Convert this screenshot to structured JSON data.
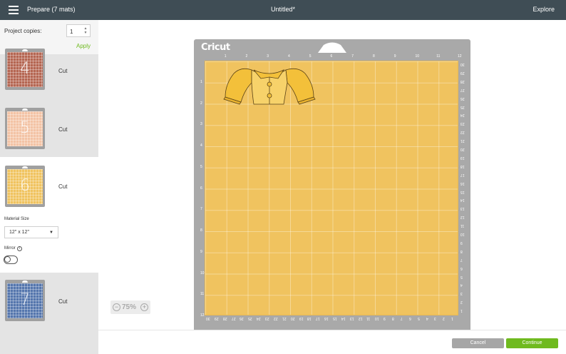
{
  "header": {
    "menu_icon": "hamburger-menu-icon",
    "title": "Prepare (7 mats)",
    "document_name": "Untitled*",
    "explore_label": "Explore"
  },
  "sidebar": {
    "copies_label": "Project copies:",
    "copies_value": "1",
    "apply_label": "Apply",
    "mats": [
      {
        "number": "4",
        "action": "Cut",
        "color": "#b56652"
      },
      {
        "number": "5",
        "action": "Cut",
        "color": "#f3c3a5"
      },
      {
        "number": "6",
        "action": "Cut",
        "color": "#f0c35f"
      },
      {
        "number": "7",
        "action": "Cut",
        "color": "#5576ad"
      }
    ],
    "material_size_label": "Material Size",
    "material_size_value": "12\" x 12\"",
    "mirror_label": "Mirror",
    "mirror_info": "i",
    "mirror_on": false
  },
  "zoom": {
    "out": "−",
    "value": "75%",
    "in": "+"
  },
  "mat": {
    "logo": "Cricut",
    "top_ruler": [
      "1",
      "2",
      "3",
      "4",
      "5",
      "6",
      "7",
      "8",
      "9",
      "10",
      "11",
      "12"
    ],
    "left_ruler": [
      "1",
      "2",
      "3",
      "4",
      "5",
      "6",
      "7",
      "8",
      "9",
      "10",
      "11",
      "12"
    ],
    "right_ruler": [
      "30",
      "29",
      "28",
      "27",
      "26",
      "25",
      "24",
      "23",
      "22",
      "21",
      "20",
      "19",
      "18",
      "17",
      "16",
      "15",
      "14",
      "13",
      "12",
      "11",
      "10",
      "9",
      "8",
      "7",
      "6",
      "5",
      "4",
      "3",
      "2",
      "1"
    ],
    "bottom_ruler": [
      "30",
      "29",
      "28",
      "27",
      "26",
      "25",
      "24",
      "23",
      "22",
      "21",
      "20",
      "19",
      "18",
      "17",
      "16",
      "15",
      "14",
      "13",
      "12",
      "11",
      "10",
      "9",
      "8",
      "7",
      "6",
      "5",
      "4",
      "3",
      "2",
      "1"
    ],
    "background_color": "#f0c35f"
  },
  "footer": {
    "cancel_label": "Cancel",
    "continue_label": "Continue"
  }
}
